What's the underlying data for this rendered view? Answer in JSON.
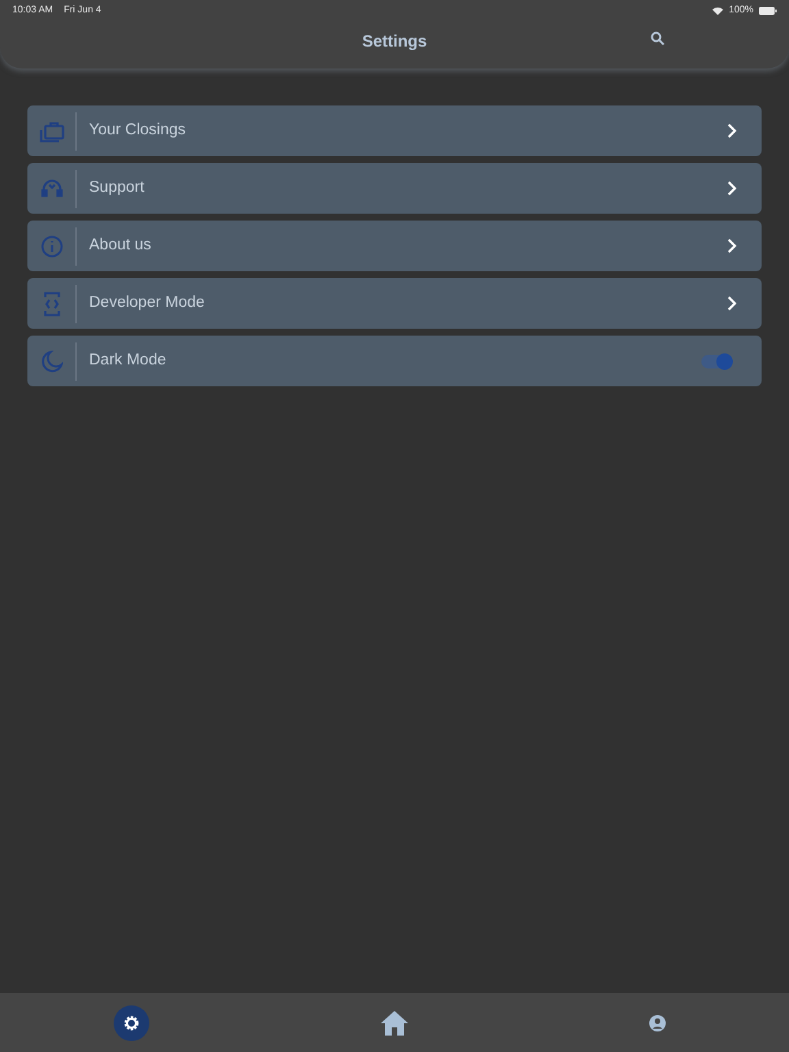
{
  "status_bar": {
    "time": "10:03 AM",
    "date": "Fri Jun 4",
    "battery": "100%"
  },
  "header": {
    "title": "Settings"
  },
  "settings": [
    {
      "kind": "link",
      "label": "Your Closings"
    },
    {
      "kind": "link",
      "label": "Support"
    },
    {
      "kind": "link",
      "label": "About us"
    },
    {
      "kind": "link",
      "label": "Developer Mode"
    },
    {
      "kind": "toggle",
      "label": "Dark Mode",
      "on": true
    }
  ],
  "bottom_nav": [
    {
      "selected": true
    },
    {
      "selected": false
    },
    {
      "selected": false
    }
  ]
}
